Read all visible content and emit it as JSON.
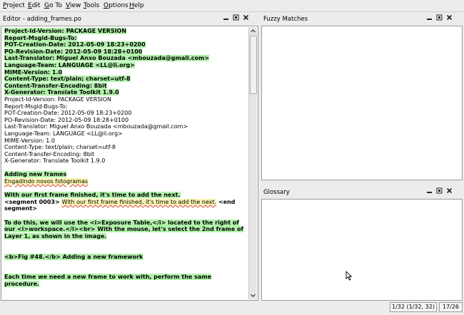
{
  "menubar": {
    "items": [
      {
        "label": "Project"
      },
      {
        "label": "Edit"
      },
      {
        "label": "Go To"
      },
      {
        "label": "View"
      },
      {
        "label": "Tools"
      },
      {
        "label": "Options"
      },
      {
        "label": "Help"
      }
    ]
  },
  "editor": {
    "title": "Editor - adding_frames.po",
    "header_source": [
      "Project-Id-Version: PACKAGE VERSION",
      "Report-Msgid-Bugs-To:",
      "POT-Creation-Date: 2012-05-09 18:23+0200",
      "PO-Revision-Date: 2012-05-09 18:28+0100",
      "Last-Translator: Miguel Anxo Bouzada <mbouzada@gmail.com>",
      "Language-Team: LANGUAGE <LL@li.org>",
      "MIME-Version: 1.0",
      "Content-Type: text/plain; charset=utf-8",
      "Content-Transfer-Encoding: 8bit",
      "X-Generator: Translate Toolkit 1.9.0"
    ],
    "header_target": [
      "Project-Id-Version: PACKAGE VERSION",
      "Report-Msgid-Bugs-To:",
      "POT-Creation-Date: 2012-05-09 18:23+0200",
      "PO-Revision-Date: 2012-05-09 18:28+0100",
      "Last-Translator: Miguel Anxo Bouzada <mbouzada@gmail.com>",
      "Language-Team: LANGUAGE <LL@li.org>",
      "MIME-Version: 1.0",
      "Content-Type: text/plain; charset=utf-8",
      "Content-Transfer-Encoding: 8bit",
      "X-Generator: Translate Toolkit 1.9.0"
    ],
    "seg_adding_source": "Adding new frames",
    "seg_adding_target": "Engadindo novos fotogramas",
    "seg_first_source": "With our first frame finished, it's time to add the next.",
    "seg_active_prefix": "<segment 0003>",
    "seg_active_text": "With our first frame finished, it's time to add the next.",
    "seg_active_suffix_1": "<end",
    "seg_active_suffix_2": "segment>",
    "seg_todo_1": "To do this, we will use the <i>Exposure Table,</i> located to the right of",
    "seg_todo_2": "our <i>workspace.</i><br> With the mouse, let's select the 2nd frame of",
    "seg_todo_3": "Layer 1, as shown in the image.",
    "seg_fig": "<b>Fig #48.</b> Adding a new framework",
    "seg_each_1": "Each time we need a new frame to work with, perform the same",
    "seg_each_2": "procedure."
  },
  "fuzzy": {
    "title": "Fuzzy Matches"
  },
  "glossary": {
    "title": "Glossary"
  },
  "status": {
    "position": "1/32 (1/32, 32)",
    "progress": "17/26"
  }
}
